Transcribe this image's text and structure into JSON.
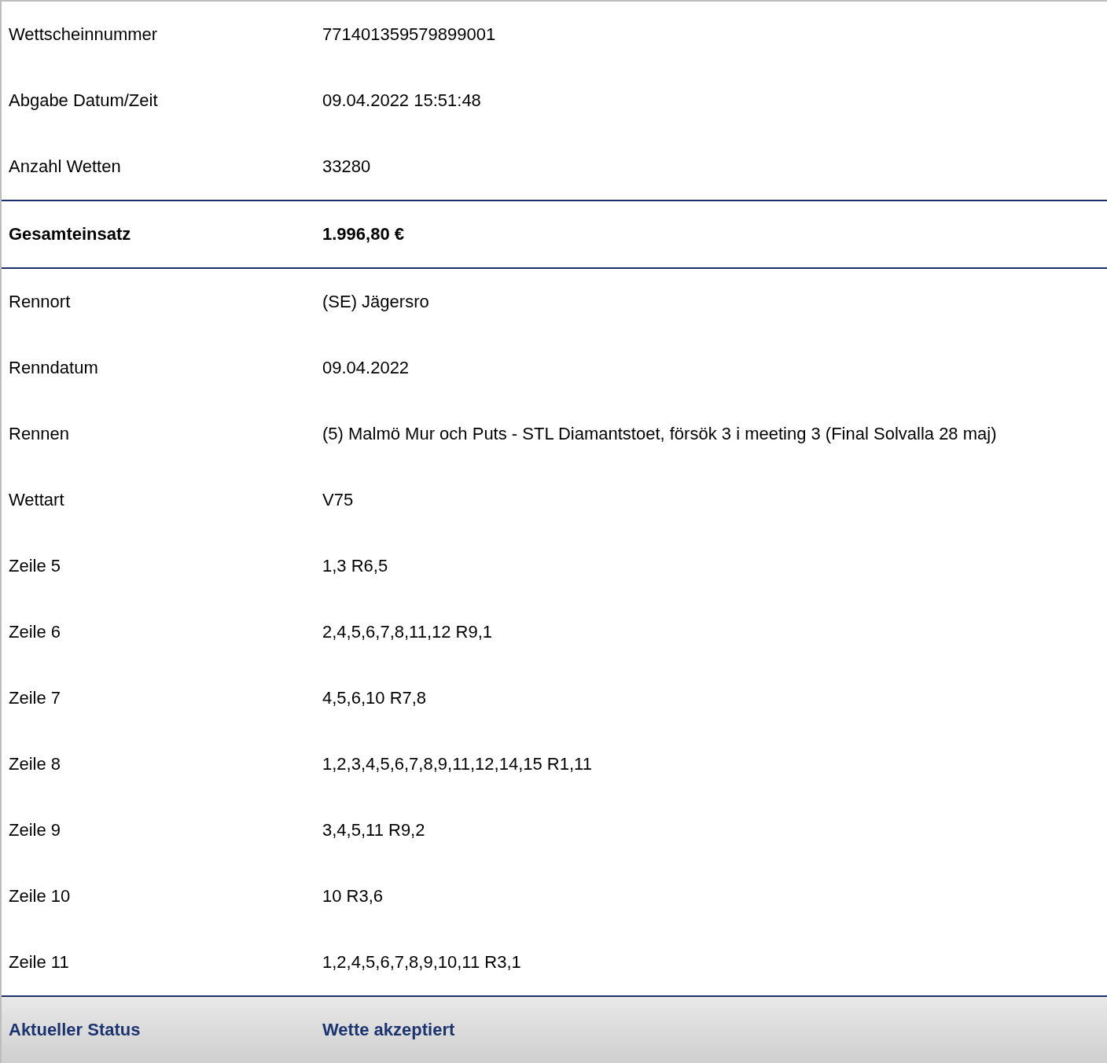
{
  "rows": [
    {
      "kind": "plain",
      "label": "Wettscheinnummer",
      "value": "771401359579899001"
    },
    {
      "kind": "plain",
      "label": "Abgabe Datum/Zeit",
      "value": "09.04.2022 15:51:48"
    },
    {
      "kind": "plain",
      "label": "Anzahl Wetten",
      "value": "33280"
    },
    {
      "kind": "total",
      "label": "Gesamteinsatz",
      "value": "1.996,80 €"
    },
    {
      "kind": "plain",
      "label": "Rennort",
      "value": "(SE) Jägersro"
    },
    {
      "kind": "plain",
      "label": "Renndatum",
      "value": "09.04.2022"
    },
    {
      "kind": "plain",
      "label": "Rennen",
      "value": "(5) Malmö Mur och Puts - STL Diamantstoet, försök 3 i meeting 3 (Final Solvalla 28 maj)"
    },
    {
      "kind": "plain",
      "label": "Wettart",
      "value": "V75"
    },
    {
      "kind": "plain",
      "label": "Zeile 5",
      "value": "1,3 R6,5"
    },
    {
      "kind": "plain",
      "label": "Zeile 6",
      "value": "2,4,5,6,7,8,11,12 R9,1"
    },
    {
      "kind": "plain",
      "label": "Zeile 7",
      "value": "4,5,6,10 R7,8"
    },
    {
      "kind": "plain",
      "label": "Zeile 8",
      "value": "1,2,3,4,5,6,7,8,9,11,12,14,15 R1,11"
    },
    {
      "kind": "plain",
      "label": "Zeile 9",
      "value": "3,4,5,11 R9,2"
    },
    {
      "kind": "plain",
      "label": "Zeile 10",
      "value": "10 R3,6"
    },
    {
      "kind": "plain",
      "label": "Zeile 11",
      "value": "1,2,4,5,6,7,8,9,10,11 R3,1"
    },
    {
      "kind": "status",
      "label": "Aktueller Status",
      "value": "Wette akzeptiert"
    }
  ]
}
